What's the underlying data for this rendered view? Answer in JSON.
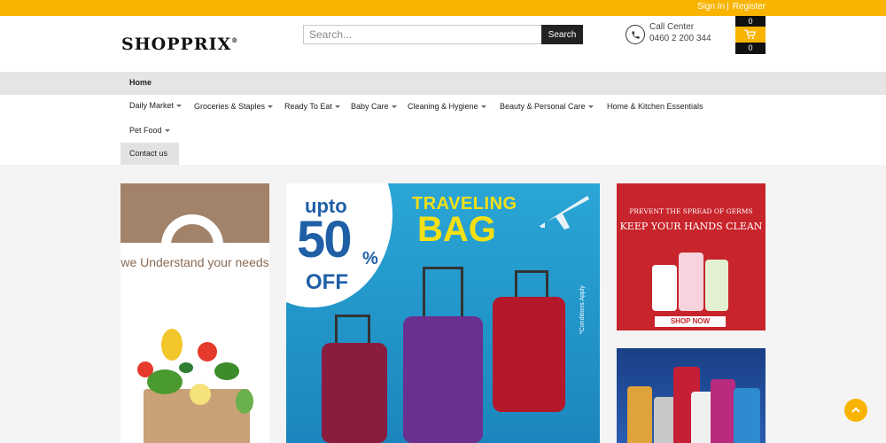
{
  "topbar": {
    "signin": "Sign In",
    "separator": "|",
    "register": "Register"
  },
  "header": {
    "logo": "SHOPPRIX",
    "logo_mark": "®",
    "search": {
      "placeholder": "Search...",
      "value": "",
      "button": "Search"
    },
    "call_center": {
      "label": "Call Center",
      "number": "0460 2 200 344"
    },
    "cart": {
      "count_top": "0",
      "count_bottom": "0"
    }
  },
  "nav": {
    "home": "Home",
    "items": [
      {
        "label": "Daily Market",
        "dropdown": true
      },
      {
        "label": "Groceries & Staples",
        "dropdown": true
      },
      {
        "label": "Ready To Eat",
        "dropdown": true
      },
      {
        "label": "Baby Care",
        "dropdown": true
      },
      {
        "label": "Cleaning & Hygiene",
        "dropdown": true
      },
      {
        "label": "Beauty & Personal Care",
        "dropdown": true
      },
      {
        "label": "Home & Kitchen Essentials",
        "dropdown": false
      },
      {
        "label": "Pet Food",
        "dropdown": true
      }
    ],
    "contact": "Contact us"
  },
  "banners": {
    "left": {
      "tagline": "we Understand your needs"
    },
    "center": {
      "upto": "upto",
      "percent": "50",
      "percent_sign": "%",
      "off": "OFF",
      "line1": "TRAVELING",
      "line2": "BAG",
      "conditions": "*Conditions Apply"
    },
    "right_top": {
      "line1": "PREVENT THE SPREAD OF GERMS",
      "line2": "KEEP YOUR HANDS CLEAN",
      "cta": "SHOP NOW"
    }
  },
  "colors": {
    "accent": "#f8b400",
    "dark": "#222222",
    "promo_red": "#c8242b",
    "promo_blue": "#2aa6d6"
  },
  "icons": [
    "phone-icon",
    "cart-icon",
    "caret-down-icon",
    "airplane-icon",
    "arrow-up-icon"
  ]
}
